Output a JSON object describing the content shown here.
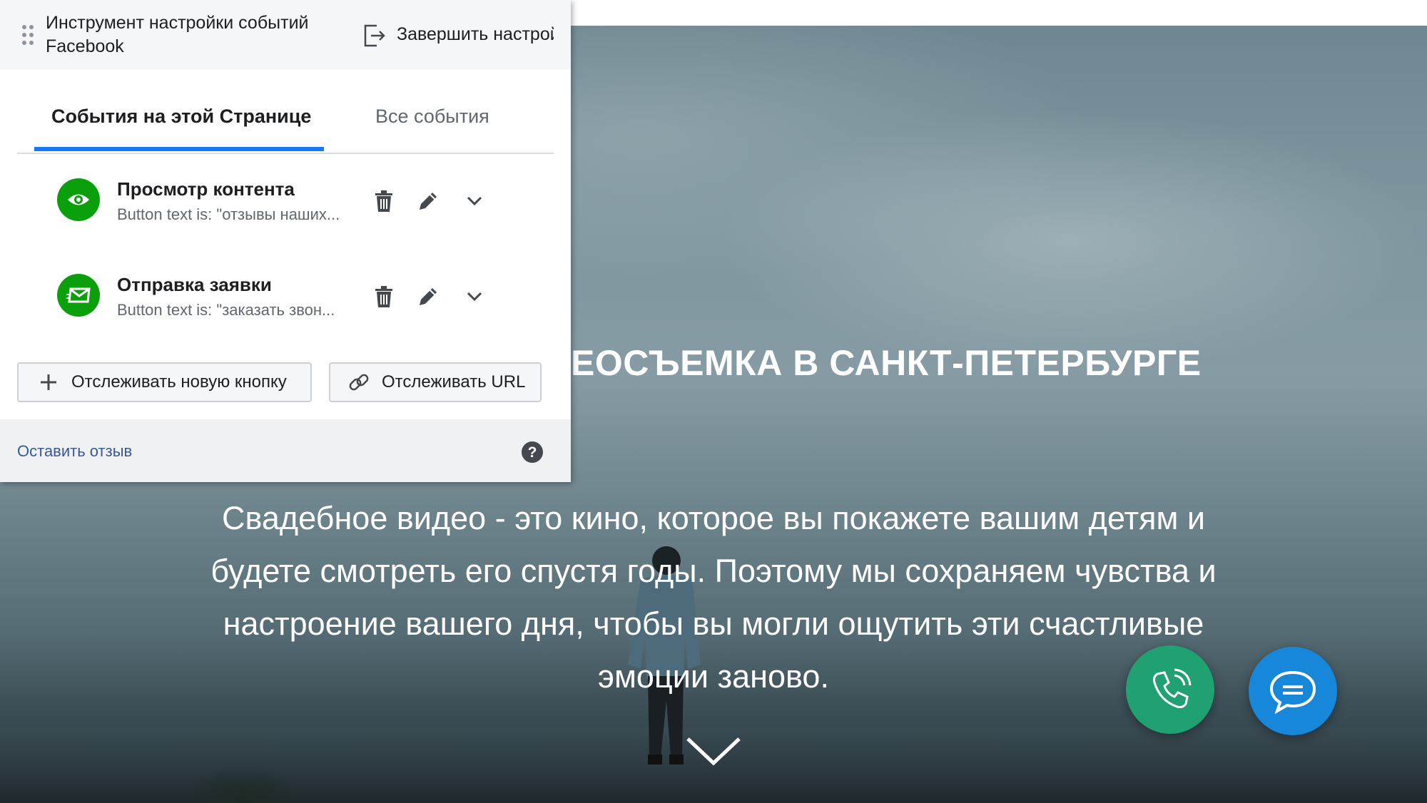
{
  "panel": {
    "title": "Инструмент настройки событий Facebook",
    "finish_label": "Завершить настрой",
    "tabs": [
      {
        "label": "События на этой Странице",
        "active": true
      },
      {
        "label": "Все события",
        "active": false
      }
    ],
    "events": [
      {
        "icon": "eye-icon",
        "title": "Просмотр контента",
        "description": "Button text is: \"отзывы наших..."
      },
      {
        "icon": "envelope-icon",
        "title": "Отправка заявки",
        "description": "Button text is: \"заказать звон..."
      }
    ],
    "track_button_label": "Отслеживать новую кнопку",
    "track_url_label": "Отслеживать URL",
    "feedback_label": "Оставить отзыв"
  },
  "hero": {
    "title": "ЕОСЪЕМКА В САНКТ-ПЕТЕРБУРГЕ",
    "subtitle": "Свадебное видео - это кино, которое вы покажете вашим детям и будете смотреть его спустя годы. Поэтому мы сохраняем чувства и настроение вашего дня, чтобы вы могли ощутить эти счастливые эмоции заново."
  },
  "colors": {
    "accent_blue": "#1877f2",
    "event_green": "#0ba00b",
    "call_button": "#1fa171",
    "chat_button": "#1787d9",
    "link": "#385898"
  }
}
